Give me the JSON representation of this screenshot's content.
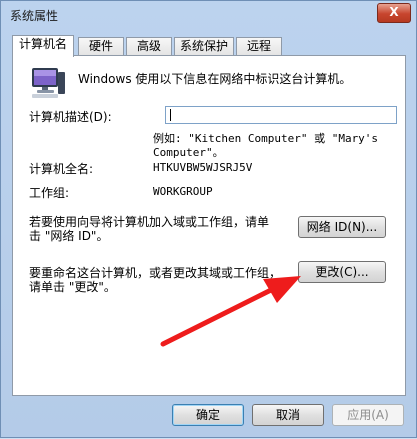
{
  "window": {
    "title": "系统属性",
    "close_glyph": "X"
  },
  "tabs": [
    {
      "label": "计算机名",
      "active": true
    },
    {
      "label": "硬件",
      "active": false
    },
    {
      "label": "高级",
      "active": false
    },
    {
      "label": "系统保护",
      "active": false
    },
    {
      "label": "远程",
      "active": false
    }
  ],
  "panel": {
    "intro": "Windows 使用以下信息在网络中标识这台计算机。",
    "description_label": "计算机描述(D):",
    "description_value": "",
    "example_line1": "例如: \"Kitchen Computer\" 或 \"Mary's",
    "example_line2": "Computer\"。",
    "full_name_label": "计算机全名:",
    "full_name_value": "HTKUVBW5WJSRJ5V",
    "workgroup_label": "工作组:",
    "workgroup_value": "WORKGROUP",
    "network_text_line1": "若要使用向导将计算机加入域或工作组，请单",
    "network_text_line2": "击 \"网络 ID\"。",
    "network_id_button": "网络 ID(N)...",
    "rename_text_line1": "要重命名这台计算机，或者更改其域或工作组，",
    "rename_text_line2": "请单击 \"更改\"。",
    "change_button": "更改(C)..."
  },
  "footer": {
    "ok": "确定",
    "cancel": "取消",
    "apply": "应用(A)"
  },
  "colors": {
    "arrow": "#ee1c1c",
    "titlebar": "#bcd3ee",
    "close_button": "#c7452e"
  },
  "icons": [
    "computer-icon",
    "close-icon",
    "red-arrow-annotation"
  ]
}
